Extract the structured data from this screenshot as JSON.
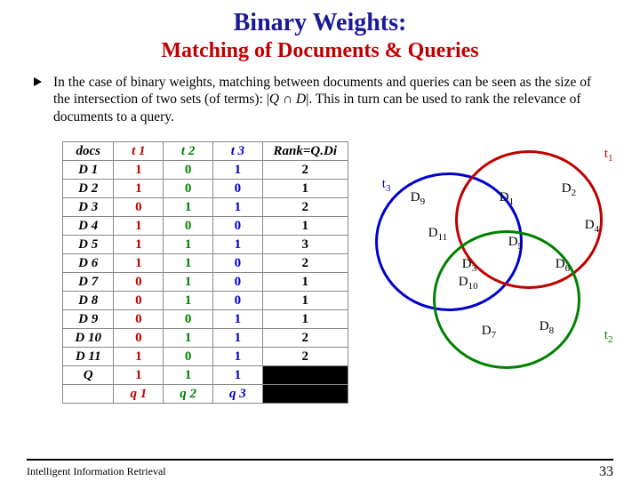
{
  "title_line1": "Binary Weights:",
  "title_line2": "Matching of Documents & Queries",
  "body_prefix": "In the case of binary weights, matching between documents and queries can be seen as the size of the intersection of two sets (of terms): |",
  "body_q": "Q",
  "body_inter": " ∩ ",
  "body_d": "D",
  "body_suffix": "|. This in turn can be used to rank the relevance of documents to a query.",
  "headers": {
    "docs": "docs",
    "t1": "t 1",
    "t2": "t 2",
    "t3": "t 3",
    "rank": "Rank=Q.Di"
  },
  "rows": [
    {
      "d": "D 1",
      "t1": "1",
      "t2": "0",
      "t3": "1",
      "r": "2"
    },
    {
      "d": "D 2",
      "t1": "1",
      "t2": "0",
      "t3": "0",
      "r": "1"
    },
    {
      "d": "D 3",
      "t1": "0",
      "t2": "1",
      "t3": "1",
      "r": "2"
    },
    {
      "d": "D 4",
      "t1": "1",
      "t2": "0",
      "t3": "0",
      "r": "1"
    },
    {
      "d": "D 5",
      "t1": "1",
      "t2": "1",
      "t3": "1",
      "r": "3"
    },
    {
      "d": "D 6",
      "t1": "1",
      "t2": "1",
      "t3": "0",
      "r": "2"
    },
    {
      "d": "D 7",
      "t1": "0",
      "t2": "1",
      "t3": "0",
      "r": "1"
    },
    {
      "d": "D 8",
      "t1": "0",
      "t2": "1",
      "t3": "0",
      "r": "1"
    },
    {
      "d": "D 9",
      "t1": "0",
      "t2": "0",
      "t3": "1",
      "r": "1"
    },
    {
      "d": "D 10",
      "t1": "0",
      "t2": "1",
      "t3": "1",
      "r": "2"
    },
    {
      "d": "D 11",
      "t1": "1",
      "t2": "0",
      "t3": "1",
      "r": "2"
    }
  ],
  "qrow": {
    "d": "Q",
    "t1": "1",
    "t2": "1",
    "t3": "1"
  },
  "qsub": {
    "t1": "q 1",
    "t2": "q 2",
    "t3": "q 3"
  },
  "venn_labels": {
    "t1": "t",
    "t1s": "1",
    "t2": "t",
    "t2s": "2",
    "t3": "t",
    "t3s": "3",
    "d1": "D",
    "d1s": "1",
    "d2": "D",
    "d2s": "2",
    "d3": "D",
    "d3s": "3",
    "d4": "D",
    "d4s": "4",
    "d5": "D",
    "d5s": "5",
    "d6": "D",
    "d6s": "6",
    "d7": "D",
    "d7s": "7",
    "d8": "D",
    "d8s": "8",
    "d9": "D",
    "d9s": "9",
    "d10": "D",
    "d10s": "10",
    "d11": "D",
    "d11s": "11"
  },
  "footer_left": "Intelligent Information Retrieval",
  "footer_right": "33"
}
